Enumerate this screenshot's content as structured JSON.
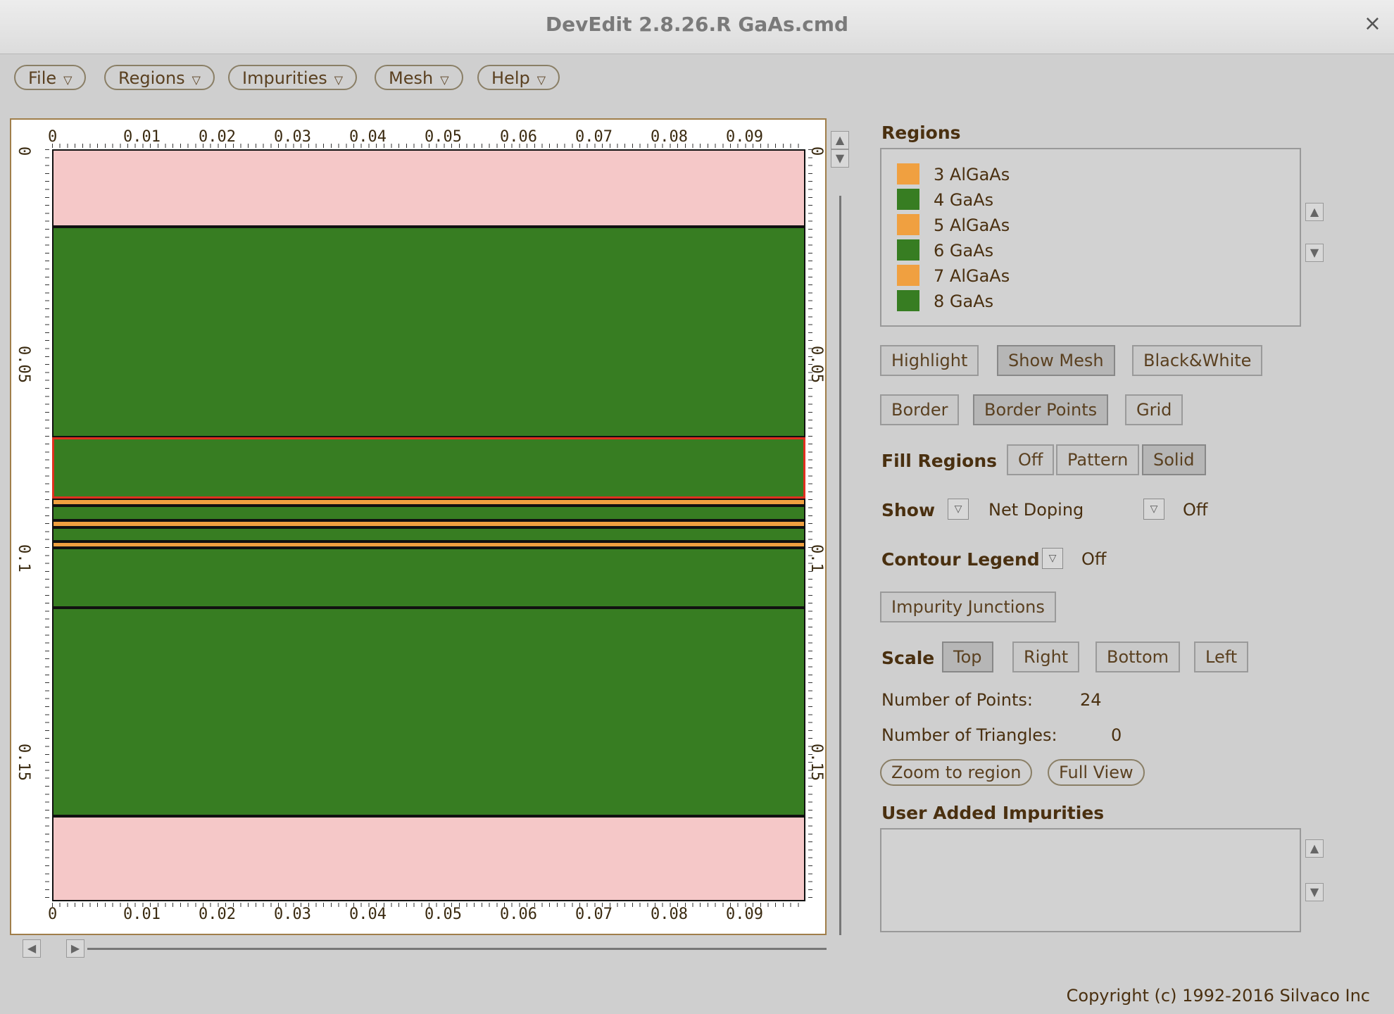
{
  "window": {
    "title": "DevEdit 2.8.26.R GaAs.cmd",
    "close_glyph": "×"
  },
  "menubar": [
    {
      "label": "File"
    },
    {
      "label": "Regions"
    },
    {
      "label": "Impurities"
    },
    {
      "label": "Mesh"
    },
    {
      "label": "Help"
    }
  ],
  "canvas": {
    "x_ticks": [
      "0",
      "0.01",
      "0.02",
      "0.03",
      "0.04",
      "0.05",
      "0.06",
      "0.07",
      "0.08",
      "0.09"
    ],
    "y_ticks": [
      "0",
      "0.05",
      "0.1",
      "0.15"
    ],
    "layers": [
      {
        "material": "pink",
        "y0": 0,
        "y1": 0.0195,
        "color": "#f5c8c8"
      },
      {
        "material": "GaAs",
        "y0": 0.0195,
        "y1": 0.0725,
        "color": "#377d22"
      },
      {
        "material": "GaAs",
        "y0": 0.0725,
        "y1": 0.088,
        "color": "#377d22",
        "highlighted": true
      },
      {
        "material": "AlGaAs",
        "y0": 0.088,
        "y1": 0.0898,
        "color": "#f0a040"
      },
      {
        "material": "GaAs",
        "y0": 0.0898,
        "y1": 0.0935,
        "color": "#377d22"
      },
      {
        "material": "AlGaAs",
        "y0": 0.0935,
        "y1": 0.0952,
        "color": "#f0a040"
      },
      {
        "material": "GaAs",
        "y0": 0.0952,
        "y1": 0.0988,
        "color": "#377d22"
      },
      {
        "material": "AlGaAs",
        "y0": 0.0988,
        "y1": 0.1005,
        "color": "#f0a040"
      },
      {
        "material": "GaAs",
        "y0": 0.1005,
        "y1": 0.1155,
        "color": "#377d22"
      },
      {
        "material": "GaAs",
        "y0": 0.1155,
        "y1": 0.168,
        "color": "#377d22"
      },
      {
        "material": "pink",
        "y0": 0.168,
        "y1": 0.1895,
        "color": "#f5c8c8"
      }
    ]
  },
  "panel": {
    "regions_label": "Regions",
    "regions": [
      {
        "label": "3 AlGaAs",
        "color": "#f0a040"
      },
      {
        "label": "4 GaAs",
        "color": "#377d22"
      },
      {
        "label": "5 AlGaAs",
        "color": "#f0a040"
      },
      {
        "label": "6 GaAs",
        "color": "#377d22"
      },
      {
        "label": "7 AlGaAs",
        "color": "#f0a040"
      },
      {
        "label": "8 GaAs",
        "color": "#377d22"
      }
    ],
    "buttons_row1": [
      "Highlight",
      "Show Mesh",
      "Black&White"
    ],
    "buttons_row2": [
      "Border",
      "Border Points",
      "Grid"
    ],
    "fill_regions_label": "Fill Regions",
    "fill_regions_opts": [
      "Off",
      "Pattern",
      "Solid"
    ],
    "fill_regions_selected": "Solid",
    "show_label": "Show",
    "show_value": "Net Doping",
    "show_value2": "Off",
    "contour_label": "Contour Legend",
    "contour_value": "Off",
    "impurity_junctions": "Impurity Junctions",
    "scale_label": "Scale",
    "scale_opts": [
      "Top",
      "Right",
      "Bottom",
      "Left"
    ],
    "scale_selected": "Top",
    "num_points_label": "Number of Points:",
    "num_points": "24",
    "num_triangles_label": "Number of Triangles:",
    "num_triangles": "0",
    "zoom_region": "Zoom to region",
    "full_view": "Full View",
    "user_impurities_label": "User Added Impurities"
  },
  "copyright": "Copyright (c) 1992-2016 Silvaco Inc"
}
